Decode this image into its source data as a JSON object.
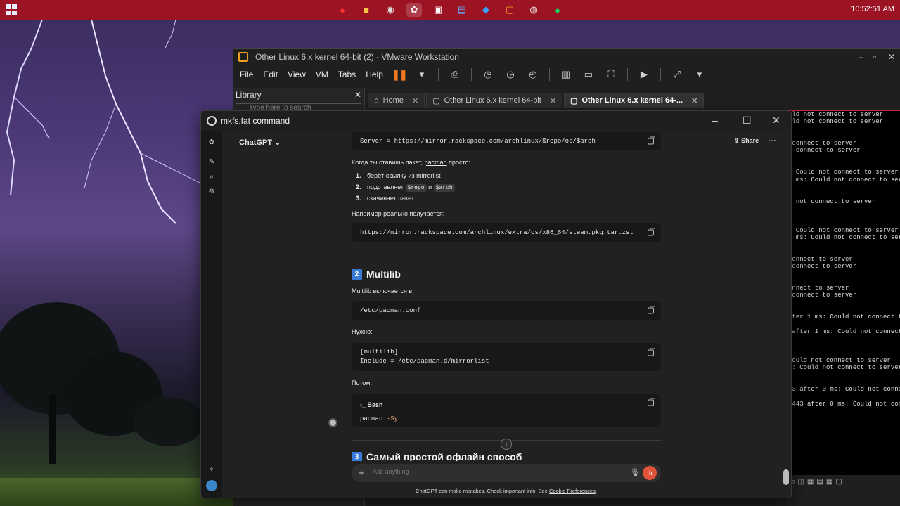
{
  "taskbar": {
    "clock": "10:52:51 AM",
    "icons": [
      "opera-icon",
      "file-explorer-icon",
      "obs-icon",
      "chatgpt-icon",
      "terminal-icon",
      "notepad-icon",
      "vscode-icon",
      "vmware-icon",
      "github-icon",
      "spotify-icon"
    ]
  },
  "vmware": {
    "title": "Other Linux 6.x kernel 64-bit (2) - VMware Workstation",
    "menu": [
      "File",
      "Edit",
      "View",
      "VM",
      "Tabs",
      "Help"
    ],
    "library": {
      "title": "Library",
      "search_placeholder": "Type here to search"
    },
    "tabs": [
      {
        "label": "Home"
      },
      {
        "label": "Other Linux 6.x kernel 64-bit"
      },
      {
        "label": "Other Linux 6.x kernel 64-..."
      }
    ],
    "console_lines": [
      "uld not connect to server",
      "uld not connect to server",
      "",
      "",
      " connect to server",
      "t connect to server",
      "",
      "",
      ": Could not connect to server",
      "s ms: Could not connect to server",
      "",
      "",
      "d not connect to server",
      "",
      "",
      "",
      ": Could not connect to server",
      "s ms: Could not connect to server",
      "",
      "",
      "connect to server",
      " connect to server",
      "",
      "",
      "onnect to server",
      " connect to server",
      "",
      "",
      "fter 1 ms: Could not connect to s",
      "",
      " after 1 ms: Could not connect",
      "",
      "",
      "",
      "Could not connect to server",
      "s: Could not connect to server",
      "",
      "",
      "43 after 0 ms: Could not connect",
      "",
      " 443 after 0 ms: Could not conne",
      "",
      "",
      "",
      "",
      "                                :("
    ]
  },
  "chatgpt": {
    "window_title": "mkfs.fat command",
    "model_selector": "ChatGPT",
    "share_label": "Share",
    "content": {
      "code_server": "Server = https://mirror.rackspace.com/archlinux/$repo/os/$arch",
      "p_when": "Когда ты ставишь пакет,",
      "p_pacman": "pacman",
      "p_simply": "просто:",
      "steps": [
        {
          "num": "1.",
          "text": "берёт ссылку из mirrorlist"
        },
        {
          "num": "2.",
          "pre": "подставляет",
          "chip1": "$repo",
          "mid": "и",
          "chip2": "$arch"
        },
        {
          "num": "3.",
          "text": "скачивает пакет."
        }
      ],
      "p_example": "Например реально получается:",
      "code_url": "https://mirror.rackspace.com/archlinux/extra/os/x86_64/steam.pkg.tar.zst",
      "h2_num": "2",
      "h2_text": "Multilib",
      "p_multilib": "Multilib включается в:",
      "code_conf": "/etc/pacman.conf",
      "p_need": "Нужно:",
      "code_multilib_1": "[multilib]",
      "code_multilib_2": "Include = /etc/pacman.d/mirrorlist",
      "p_then": "Потом:",
      "bash_label": "Bash",
      "bash_cmd": "pacman",
      "bash_flag": "-Sy",
      "h3_num": "3",
      "h3_text": "Самый простой офлайн способ"
    },
    "input_placeholder": "Ask anything",
    "disclaimer_main": "ChatGPT can make mistakes. Check important info. See",
    "disclaimer_link": "Cookie Preferences",
    "disclaimer_end": "."
  }
}
